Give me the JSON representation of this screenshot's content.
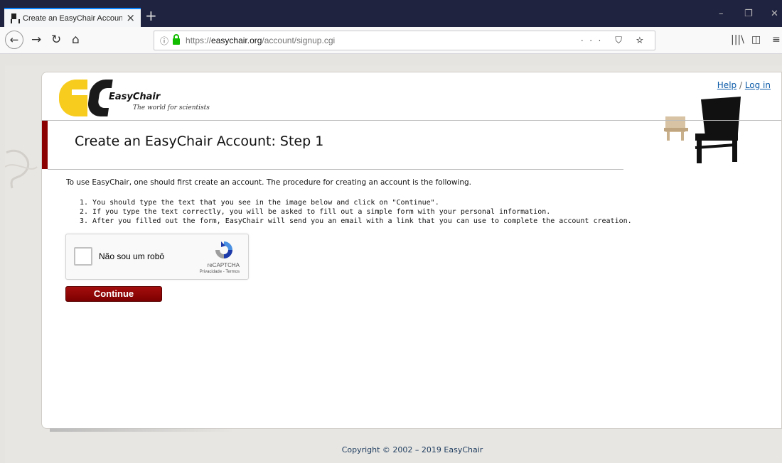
{
  "browser": {
    "tab_title": "Create an EasyChair Account: S",
    "new_tab": "+",
    "url_prefix": "https://",
    "url_host": "easychair.org",
    "url_path": "/account/signup.cgi",
    "url_actions": "··· ⛉ ☆",
    "win_min": "–",
    "win_restore": "❐",
    "win_close": "✕"
  },
  "logo": {
    "brand": "EasyChair",
    "tagline": "The world for scientists"
  },
  "links": {
    "help": "Help",
    "separator": " / ",
    "login": "Log in"
  },
  "page": {
    "title": "Create an EasyChair Account: Step 1",
    "intro": "To use EasyChair, one should first create an account. The procedure for creating an account is the following.",
    "steps": [
      "1. You should type the text that you see in the image below and click on \"Continue\".",
      "2. If you type the text correctly, you will be asked to fill out a simple form with your personal information.",
      "3. After you filled out the form, EasyChair will send you an email with a link that you can use to complete the account creation."
    ]
  },
  "recaptcha": {
    "label": "Não sou um robô",
    "brand": "reCAPTCHA",
    "links": "Privacidade - Termos"
  },
  "continue_label": "Continue",
  "footer": "Copyright © 2002 – 2019 EasyChair"
}
